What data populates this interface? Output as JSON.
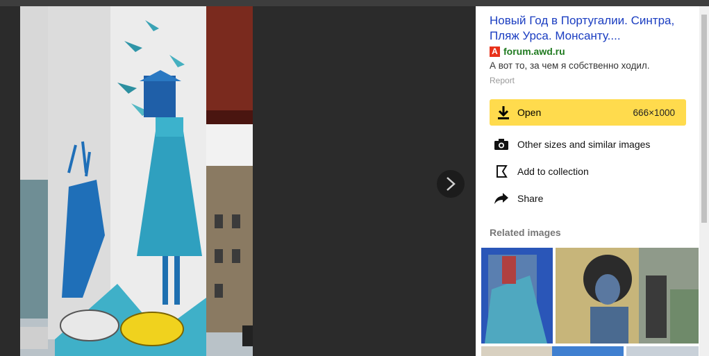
{
  "panel": {
    "title": "Новый Год в Португалии. Синтра, Пляж Урса. Монсанту....",
    "source_icon": "А",
    "source": "forum.awd.ru",
    "description": "А вот то, за чем я собственно ходил.",
    "report_label": "Report",
    "open_label": "Open",
    "open_size": "666×1000",
    "actions": [
      {
        "label": "Other sizes and similar images",
        "icon": "camera-icon"
      },
      {
        "label": "Add to collection",
        "icon": "bookmark-icon"
      },
      {
        "label": "Share",
        "icon": "share-arrow-icon"
      }
    ],
    "related_heading": "Related images"
  },
  "colors": {
    "accent_button": "#ffdb4d",
    "title_link": "#1a3dc1",
    "source_link": "#1f7a1f",
    "viewer_background": "#2b2b2b"
  }
}
